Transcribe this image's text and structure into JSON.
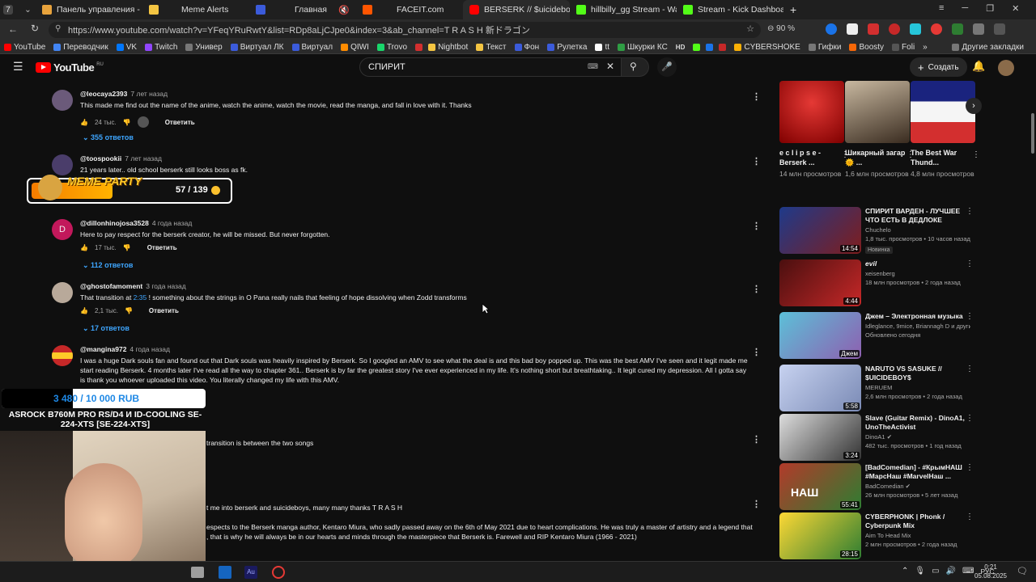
{
  "browser": {
    "tabs": [
      {
        "label": "7",
        "color": "#555"
      },
      {
        "label": "Панель управления - Пан",
        "color": "#e8a33c"
      },
      {
        "label": "Meme Alerts",
        "color": "#f4c542"
      },
      {
        "label": "Главная",
        "color": "#3b5bdb"
      },
      {
        "label": "FACEIT.com",
        "color": "#ff5500"
      },
      {
        "label": "BERSERK // $uicideboy",
        "color": "#ff0000"
      },
      {
        "label": "hillbilly_gg Stream - Watch",
        "color": "#53fc18"
      },
      {
        "label": "Stream - Kick Dashboard",
        "color": "#53fc18"
      }
    ],
    "url": "https://www.youtube.com/watch?v=YFeqYRuRwtY&list=RDp8aLjCJpe0&index=3&ab_channel=T R A S H 新ドラゴン",
    "zoom": "90 %",
    "bookmarks": [
      {
        "label": "YouTube",
        "color": "#ff0000"
      },
      {
        "label": "Переводчик",
        "color": "#4285f4"
      },
      {
        "label": "VK",
        "color": "#0077ff"
      },
      {
        "label": "Twitch",
        "color": "#9146ff"
      },
      {
        "label": "Универ",
        "color": "#777"
      },
      {
        "label": "Виртуал ЛК",
        "color": "#3b5bdb"
      },
      {
        "label": "Виртуал",
        "color": "#3b5bdb"
      },
      {
        "label": "QIWI",
        "color": "#ff8c00"
      },
      {
        "label": "Trovo",
        "color": "#19d66b"
      },
      {
        "label": "Nightbot",
        "color": "#444"
      },
      {
        "label": "Текст",
        "color": "#f4c542"
      },
      {
        "label": "Фон",
        "color": "#3b5bdb"
      },
      {
        "label": "Рулетка",
        "color": "#3b5bdb"
      },
      {
        "label": "tt",
        "color": "#111"
      },
      {
        "label": "Шкурки КС",
        "color": "#2f9e44"
      },
      {
        "label": "HD",
        "color": "#222"
      },
      {
        "label": "CYBERSHOKE",
        "color": "#fab005"
      },
      {
        "label": "Гифки",
        "color": "#777"
      },
      {
        "label": "Boosty",
        "color": "#f76707"
      },
      {
        "label": "Foli",
        "color": "#555"
      },
      {
        "label": "Другие закладки",
        "color": "#555"
      }
    ]
  },
  "youtube": {
    "logo": "YouTube",
    "region": "RU",
    "search_value": "СПИРИТ",
    "create_label": "Создать"
  },
  "comments": [
    {
      "author": "@leocaya2393",
      "time": "7 лет назад",
      "text": "This made me find out the name of the anime, watch the anime, watch the movie, read the manga, and fall in love with it. Thanks",
      "likes": "24 тыс.",
      "reply": "Ответить",
      "replies": "355 ответов",
      "avatar": "#6b5a7a"
    },
    {
      "author": "@toospookii",
      "time": "7 лет назад",
      "text": "21 years later.. old school berserk still looks boss as fk.",
      "likes": "",
      "reply": "",
      "replies": "",
      "avatar": "#4a3d6a"
    },
    {
      "author": "@dillonhinojosa3528",
      "time": "4 года назад",
      "text": "Here to pay respect for the berserk creator, he will be missed. But never forgotten.",
      "likes": "17 тыс.",
      "reply": "Ответить",
      "replies": "112 ответов",
      "avatar": "#c2185b",
      "initial": "D"
    },
    {
      "author": "@ghostofamoment",
      "time": "3 года назад",
      "text_a": "That transition at ",
      "text_link": "2:35",
      "text_b": " ! something about the strings in O Pana really nails that feeling of hope dissolving when Zodd transforms",
      "likes": "2,1 тыс.",
      "reply": "Ответить",
      "replies": "17 ответов",
      "avatar": "#b8a99a"
    },
    {
      "author": "@mangina972",
      "time": "4 года назад",
      "text": "I was a huge Dark souls fan and found out that Dark souls was heavily inspired by Berserk. So I googled an AMV to see what the deal is and this bad boy popped up. This was the best AMV I've seen and it legit made me start reading Berserk. 4 months later I've read all the way to chapter 361.. Berserk is by far the greatest story I've ever experienced in my life. It's nothing short but breathtaking.. It legit cured my depression. All I gotta say is thank you whoever uploaded this video. You literally changed my life with this AMV.",
      "avatar": "#c62828"
    },
    {
      "text": "transition is between the two songs"
    },
    {
      "text": "t me into berserk and suicideboys, many many thanks T R A S H"
    },
    {
      "text": "espects to the Berserk manga author, Kentaro Miura, who sadly passed away on the 6th of May 2021 due to heart complications. He was truly a master of artistry and a legend that",
      "text2": ", that is why he will always be in our hearts and minds through the masterpiece that Berserk is. Farewell and RIP Kentaro Miura (1966 - 2021)"
    }
  ],
  "shorts": [
    {
      "title": "e c l i p s e - Berserk ...",
      "views": "14 млн просмотров",
      "color": "#b71c1c"
    },
    {
      "title": "Шикарный загар 🌞 ...",
      "views": "1,6 млн просмотров",
      "color": "#5d4a3a"
    },
    {
      "title": "The Best War Thund...",
      "views": "4,8 млн просмотров",
      "color": "#c2185b"
    }
  ],
  "recommendations": [
    {
      "title": "СПИРИТ ВАРДЕН - ЛУЧШЕЕ ЧТО ЕСТЬ В ДЕДЛОКЕ",
      "channel": "Chuchelo",
      "meta": "1,8 тыс. просмотров • 10 часов назад",
      "badge": "Новинка",
      "duration": "14:54",
      "color": "#1e3a8a"
    },
    {
      "title": "evil",
      "channel": "xeisenberg",
      "meta": "18 млн просмотров • 2 года назад",
      "duration": "4:44",
      "color": "#7a1f1f"
    },
    {
      "title": "Джем – Электронная музыка",
      "channel": "Idleglance, 9mice, Briannagh D и другие ...",
      "meta": "Обновлено сегодня",
      "duration": "",
      "overlay": "Джем",
      "color": "#3b6e8f"
    },
    {
      "title": "NARUTO VS SASUKE // $UICIDEBOY$",
      "channel": "MERUEM",
      "meta": "2,6 млн просмотров • 2 года назад",
      "duration": "5:58",
      "color": "#9aa7c7"
    },
    {
      "title": "Slave (Guitar Remix) - DinoA1, UnoTheActivist",
      "channel": "DinoA1",
      "meta": "482 тыс. просмотров • 1 год назад",
      "duration": "3:24",
      "color": "#666"
    },
    {
      "title": "[BadComedian] - #КрымНАШ #МарсНаш #MarvelНаш ...",
      "channel": "BadComedian",
      "meta": "26 млн просмотров • 5 лет назад",
      "duration": "55:41",
      "overlay": "НАШ",
      "color": "#b23a2a"
    },
    {
      "title": "CYBERPHONK | Phonk / Cyberpunk Mix",
      "channel": "Aim To Head Mix",
      "meta": "2 млн просмотров • 2 года назад",
      "duration": "28:15",
      "color": "#2e7d32"
    }
  ],
  "overlays": {
    "meme_party": "MEME PARTY",
    "meme_count": "57 / 139",
    "goal_amount": "3 480 / 10 000 RUB",
    "goal_title": "ASROCK B760M PRO RS/D4 И ID-COOLING SE-224-XTS [SE-224-XTS]"
  },
  "taskbar": {
    "lang": "РУС",
    "time": "0:21",
    "date": "05.08.2025"
  }
}
